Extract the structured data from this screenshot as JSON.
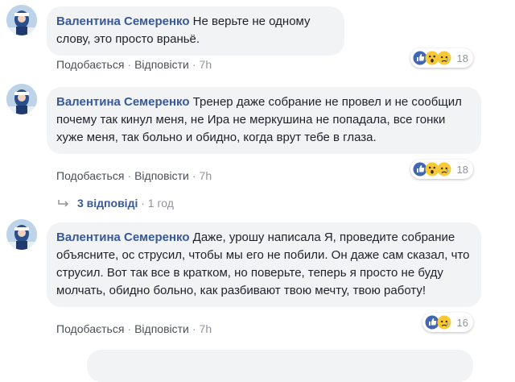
{
  "comments": [
    {
      "author": "Валентина Семеренко",
      "text": "Не верьте не одному слову, это просто враньё.",
      "like": "Подобається",
      "reply": "Відповісти",
      "time": "7h",
      "reaction_count": "18",
      "reactions": [
        "like-icon",
        "wow-icon",
        "sad-icon"
      ]
    },
    {
      "author": "Валентина Семеренко",
      "text": "Тренер даже собрание не провел и не сообщил почему так кинул меня, не Ира не меркушина не попадала, все гонки хуже меня, так больно и обидно, когда врут тебе в глаза.",
      "like": "Подобається",
      "reply": "Відповісти",
      "time": "7h",
      "reaction_count": "18",
      "reactions": [
        "like-icon",
        "wow-icon",
        "sad-icon"
      ]
    },
    {
      "author": "Валентина Семеренко",
      "text": "Даже, урошу написала Я, проведите собрание объясните, ос струсил, чтобы мы его не побили. Он даже сам сказал, что струсил. Вот так все в кратком, но поверьте, теперь я просто не буду молчать, обидно больно, как разбивают твою мечту, твою работу!",
      "like": "Подобається",
      "reply": "Відповісти",
      "time": "7h",
      "reaction_count": "16",
      "reactions": [
        "like-icon",
        "sad-icon"
      ]
    }
  ],
  "replies_link": {
    "icon": "reply-arrow-icon",
    "label": "3 відповіді",
    "time": "1 год"
  },
  "colors": {
    "author": "#385898",
    "bubble": "#f2f3f5",
    "meta": "#90949c",
    "like_blue": "#4267b2",
    "emoji_yellow": "#f7c935"
  }
}
